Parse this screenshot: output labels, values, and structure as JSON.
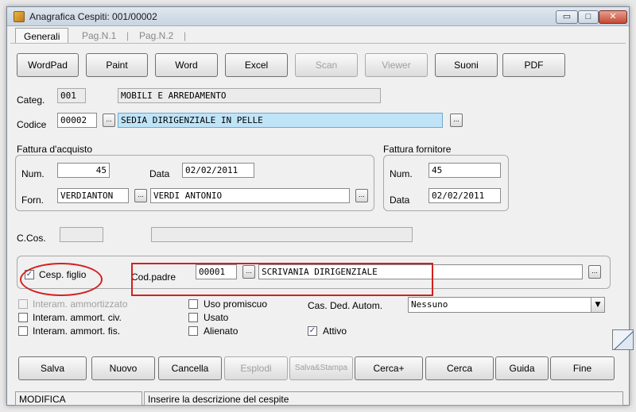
{
  "window": {
    "title": "Anagrafica Cespiti: 001/00002",
    "controls": {
      "minimize": "▭",
      "maximize": "□",
      "close": "✕"
    }
  },
  "tabs": [
    {
      "label": "Generali",
      "active": true
    },
    {
      "label": "Pag.N.1",
      "active": false
    },
    {
      "label": "Pag.N.2",
      "active": false
    }
  ],
  "tab_separator": "|",
  "toolbar": {
    "wordpad": "WordPad",
    "paint": "Paint",
    "word": "Word",
    "excel": "Excel",
    "scan": "Scan",
    "viewer": "Viewer",
    "suoni": "Suoni",
    "pdf": "PDF"
  },
  "categ": {
    "label": "Categ.",
    "code": "001",
    "description": "MOBILI E ARREDAMENTO"
  },
  "codice": {
    "label": "Codice",
    "code": "00002",
    "description": "SEDIA DIRIGENZIALE IN PELLE"
  },
  "lookup_label": "...",
  "fattura_acquisto": {
    "legend": "Fattura d'acquisto",
    "num_label": "Num.",
    "num": "45",
    "data_label": "Data",
    "data": "02/02/2011",
    "forn_label": "Forn.",
    "forn_code": "VERDIANTON",
    "forn_name": "VERDI ANTONIO"
  },
  "fattura_fornitore": {
    "legend": "Fattura fornitore",
    "num_label": "Num.",
    "num": "45",
    "data_label": "Data",
    "data": "02/02/2011"
  },
  "ccos": {
    "label": "C.Cos.",
    "code": "",
    "description": ""
  },
  "cesp_figlio": {
    "label": "Cesp. figlio",
    "checked": true
  },
  "cod_padre": {
    "label": "Cod.padre",
    "code": "00001",
    "description": "SCRIVANIA DIRIGENZIALE"
  },
  "checkmark": "✓",
  "checks": {
    "interam_ammortizzato": {
      "label": "Interam. ammortizzato",
      "checked": false,
      "enabled": false
    },
    "interam_ammort_civ": {
      "label": "Interam. ammort. civ.",
      "checked": false
    },
    "interam_ammort_fis": {
      "label": "Interam. ammort. fis.",
      "checked": false
    },
    "uso_promiscuo": {
      "label": "Uso promiscuo",
      "checked": false
    },
    "usato": {
      "label": "Usato",
      "checked": false
    },
    "alienato": {
      "label": "Alienato",
      "checked": false
    },
    "attivo": {
      "label": "Attivo",
      "checked": true
    }
  },
  "cas_ded": {
    "label": "Cas. Ded. Autom.",
    "value": "Nessuno",
    "arrow": "▼"
  },
  "actions": {
    "salva": "Salva",
    "nuovo": "Nuovo",
    "cancella": "Cancella",
    "esplodi": "Esplodi",
    "salva_stampa": "Salva&Stampa",
    "cerca_plus": "Cerca+",
    "cerca": "Cerca",
    "guida": "Guida",
    "fine": "Fine"
  },
  "status": {
    "mode": "MODIFICA",
    "hint": "Inserire la descrizione del cespite"
  }
}
